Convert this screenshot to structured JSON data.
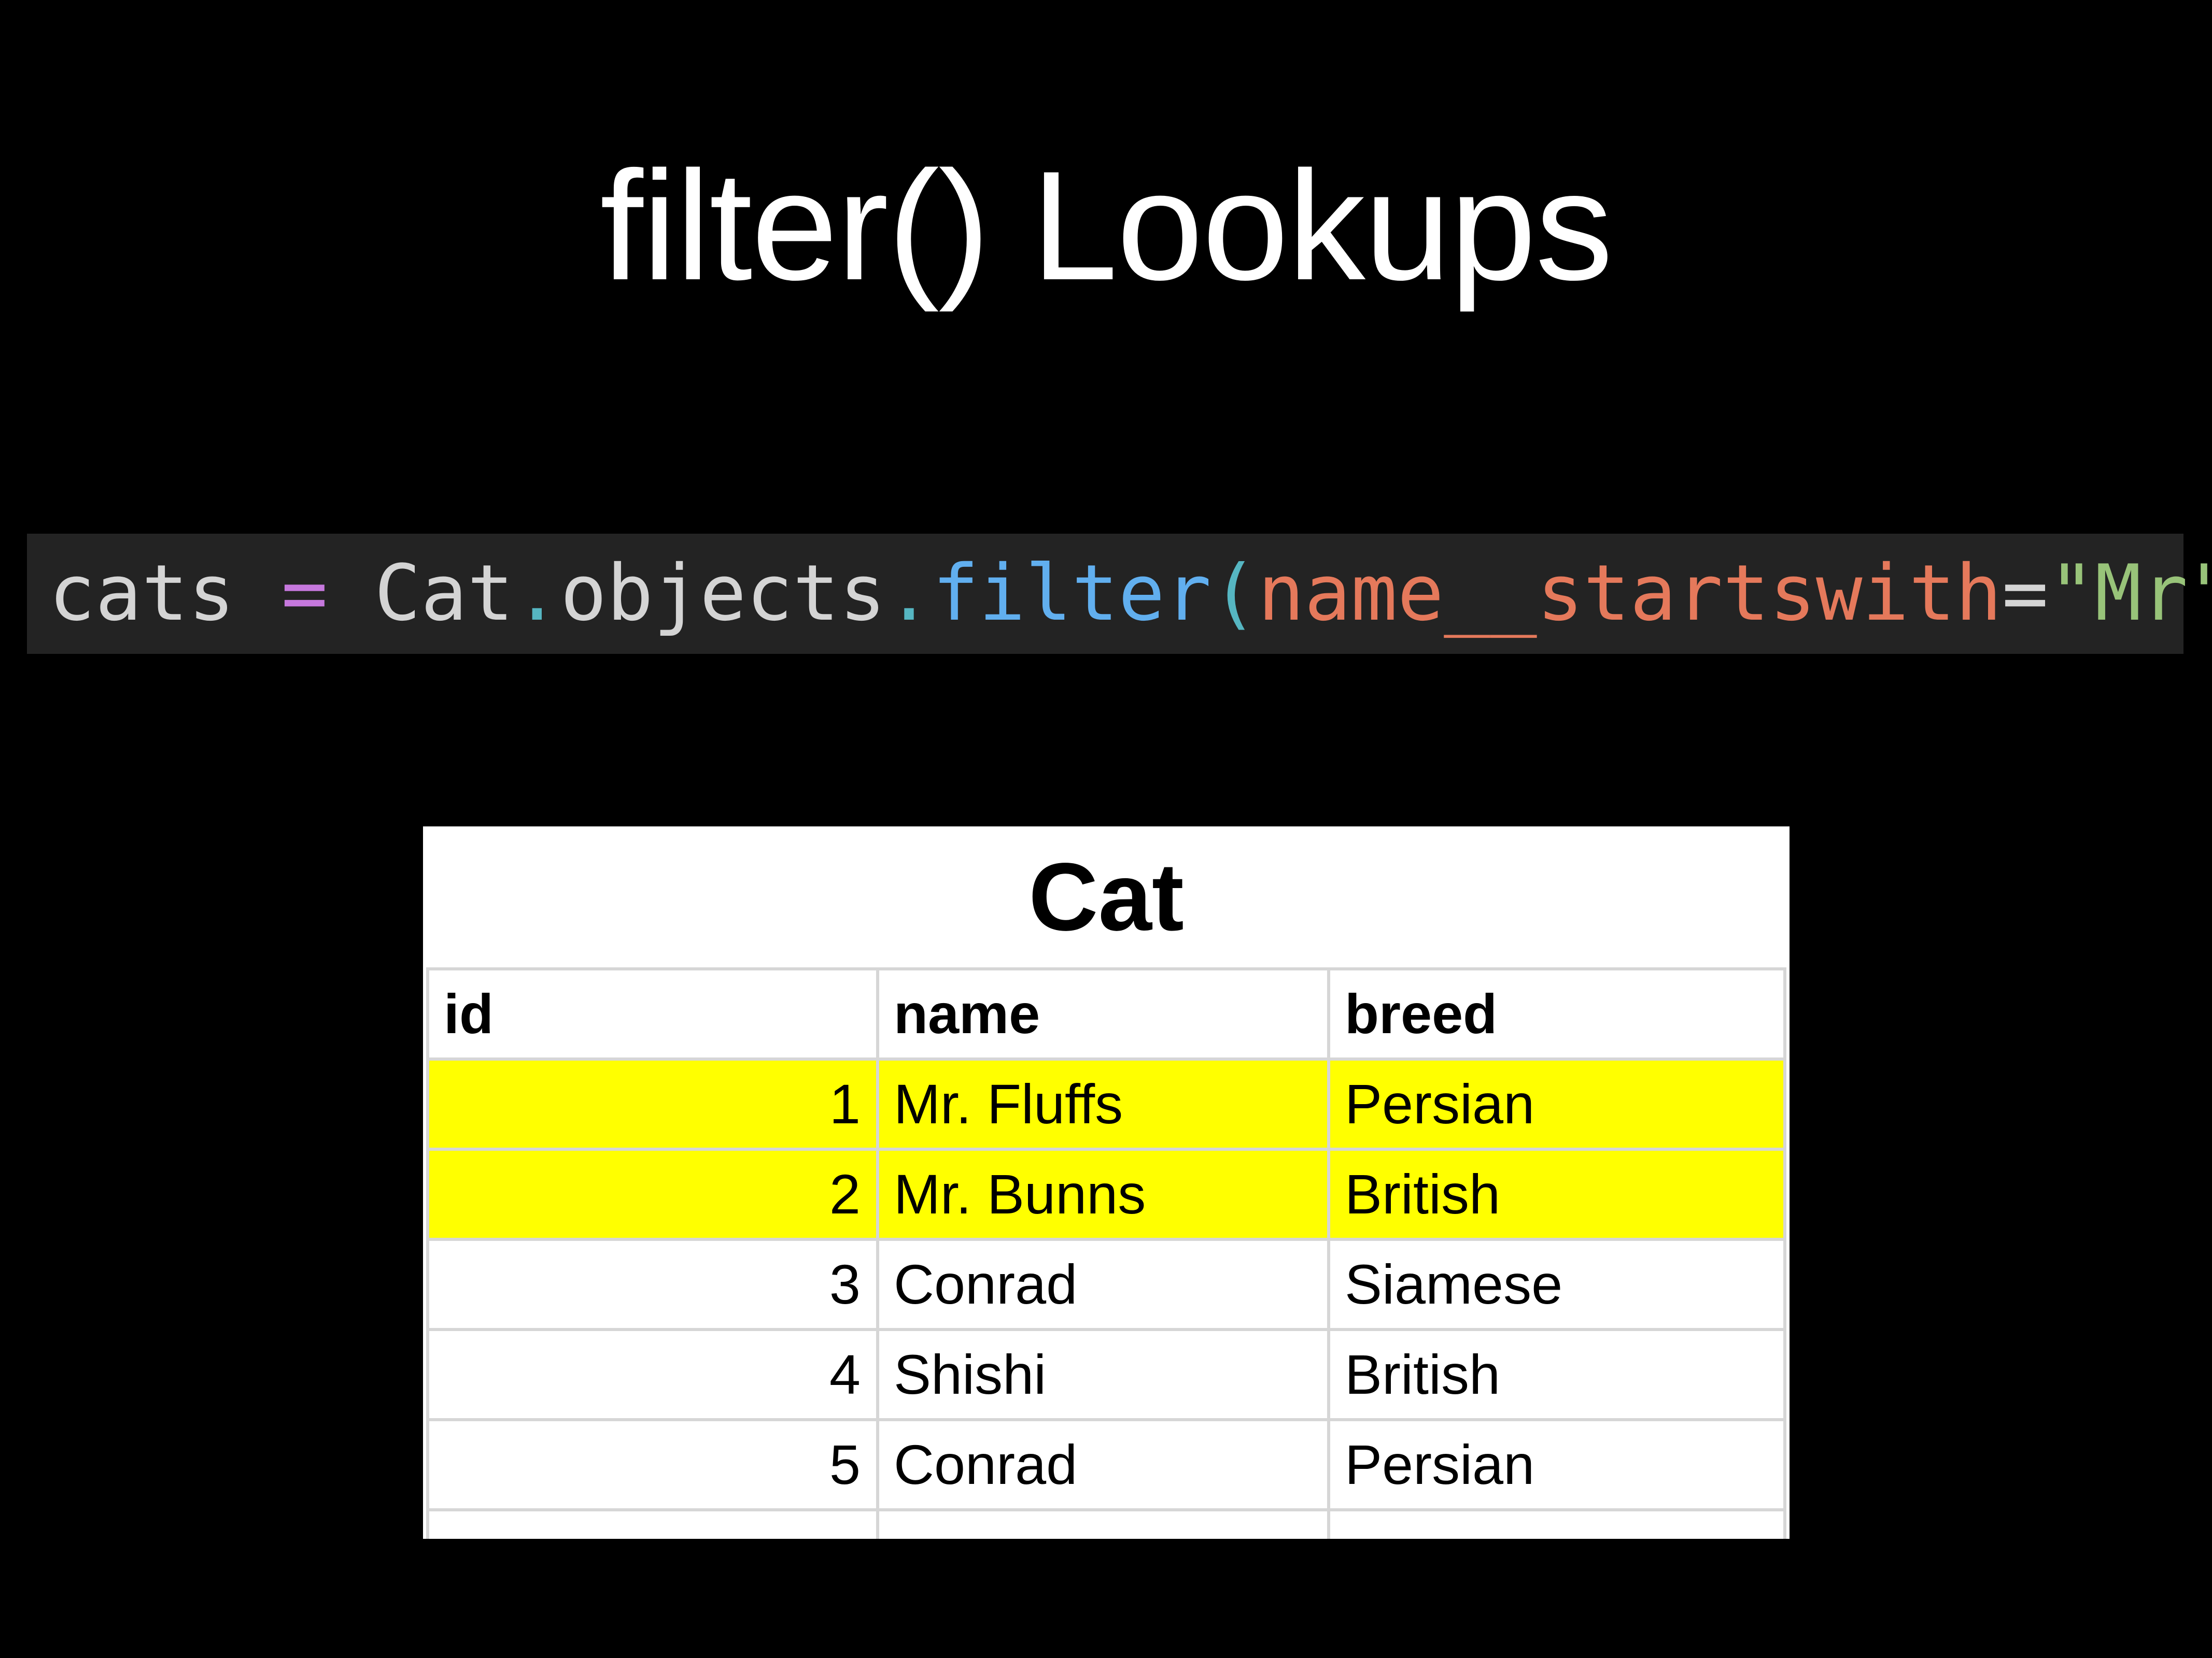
{
  "slide": {
    "title": "filter() Lookups"
  },
  "code": {
    "tokens": [
      {
        "text": "cats",
        "color": "#d4d4d4"
      },
      {
        "text": " = ",
        "color": "#c678dd"
      },
      {
        "text": "Cat",
        "color": "#d4d4d4"
      },
      {
        "text": ".",
        "color": "#56b6c2"
      },
      {
        "text": "objects",
        "color": "#d4d4d4"
      },
      {
        "text": ".",
        "color": "#56b6c2"
      },
      {
        "text": "filter",
        "color": "#61afef"
      },
      {
        "text": "(",
        "color": "#56b6c2"
      },
      {
        "text": "name__startswith",
        "color": "#e5795b"
      },
      {
        "text": "=",
        "color": "#d4d4d4"
      },
      {
        "text": "\"Mr\"",
        "color": "#98c379"
      },
      {
        "text": ")",
        "color": "#56b6c2"
      }
    ]
  },
  "table": {
    "caption": "Cat",
    "columns": [
      "id",
      "name",
      "breed"
    ],
    "highlight_color": "#ffff00",
    "rows": [
      {
        "id": "1",
        "name": "Mr. Fluffs",
        "breed": "Persian",
        "highlighted": true
      },
      {
        "id": "2",
        "name": "Mr. Bunns",
        "breed": "British",
        "highlighted": true
      },
      {
        "id": "3",
        "name": "Conrad",
        "breed": "Siamese",
        "highlighted": false
      },
      {
        "id": "4",
        "name": "Shishi",
        "breed": "British",
        "highlighted": false
      },
      {
        "id": "5",
        "name": "Conrad",
        "breed": "Persian",
        "highlighted": false
      }
    ]
  }
}
